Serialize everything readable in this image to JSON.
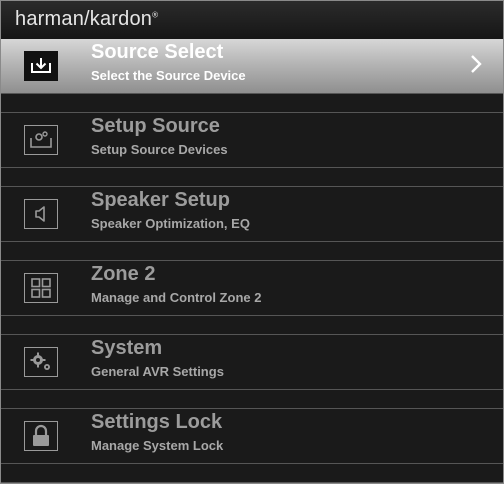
{
  "brand": {
    "logo_text": "harman/kardon",
    "registered_mark": "®"
  },
  "menu": {
    "items": [
      {
        "title": "Source Select",
        "subtitle": "Select the Source Device",
        "icon": "source-select-icon",
        "selected": true
      },
      {
        "title": "Setup Source",
        "subtitle": "Setup Source Devices",
        "icon": "setup-source-icon",
        "selected": false
      },
      {
        "title": "Speaker Setup",
        "subtitle": "Speaker Optimization, EQ",
        "icon": "speaker-icon",
        "selected": false
      },
      {
        "title": "Zone 2",
        "subtitle": "Manage and Control Zone 2",
        "icon": "zone-grid-icon",
        "selected": false
      },
      {
        "title": "System",
        "subtitle": "General AVR Settings",
        "icon": "gears-icon",
        "selected": false
      },
      {
        "title": "Settings Lock",
        "subtitle": "Manage System Lock",
        "icon": "padlock-icon",
        "selected": false
      }
    ]
  },
  "colors": {
    "background": "#1a1a1a",
    "selected_gradient_top": "#d7d7d7",
    "selected_gradient_bottom": "#8f8f8f",
    "text_inactive": "#9c9c9c",
    "text_selected": "#ffffff"
  }
}
